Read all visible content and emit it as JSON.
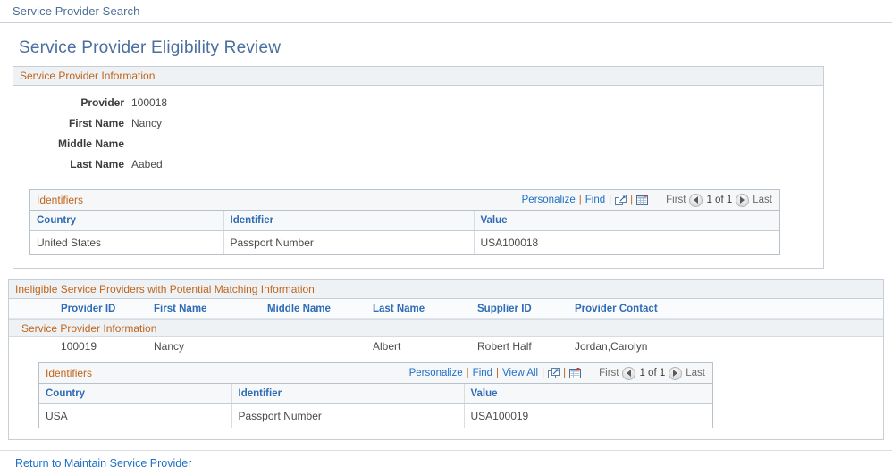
{
  "breadcrumb": {
    "label": "Service Provider Search"
  },
  "page": {
    "title": "Service Provider Eligibility Review"
  },
  "provider_info": {
    "section_title": "Service Provider Information",
    "fields": [
      {
        "label": "Provider",
        "value": "100018"
      },
      {
        "label": "First Name",
        "value": "Nancy"
      },
      {
        "label": "Middle Name",
        "value": ""
      },
      {
        "label": "Last Name",
        "value": "Aabed"
      }
    ],
    "identifiers_grid": {
      "title": "Identifiers",
      "actions": {
        "personalize": "Personalize",
        "find": "Find",
        "sep1": "|",
        "sep2": "|",
        "sep3": "|"
      },
      "pager": {
        "first": "First",
        "count": "1 of 1",
        "last": "Last"
      },
      "columns": [
        "Country",
        "Identifier",
        "Value"
      ],
      "rows": [
        {
          "country": "United States",
          "identifier": "Passport Number",
          "value": "USA100018"
        }
      ]
    }
  },
  "ineligible": {
    "section_title": "Ineligible Service Providers with Potential Matching Information",
    "columns": {
      "provider_id": "Provider ID",
      "first_name": "First Name",
      "middle_name": "Middle Name",
      "last_name": "Last Name",
      "supplier_id": "Supplier ID",
      "provider_contact": "Provider Contact"
    },
    "sub_section_title": "Service Provider Information",
    "row": {
      "provider_id": "100019",
      "first_name": "Nancy",
      "middle_name": "",
      "last_name": "Albert",
      "supplier_id": "Robert Half",
      "provider_contact": "Jordan,Carolyn"
    },
    "identifiers_grid": {
      "title": "Identifiers",
      "actions": {
        "personalize": "Personalize",
        "find": "Find",
        "view_all": "View All",
        "sep1": "|",
        "sep2": "|",
        "sep3": "|",
        "sep4": "|"
      },
      "pager": {
        "first": "First",
        "count": "1 of 1",
        "last": "Last"
      },
      "columns": [
        "Country",
        "Identifier",
        "Value"
      ],
      "rows": [
        {
          "country": "USA",
          "identifier": "Passport Number",
          "value": "USA100019"
        }
      ]
    }
  },
  "footer": {
    "return_link": "Return to Maintain Service Provider"
  },
  "colors": {
    "accent_orange": "#c0651b",
    "link_blue": "#1f6fc4",
    "title_blue": "#4a6e9e",
    "header_bg": "#eef2f5"
  }
}
